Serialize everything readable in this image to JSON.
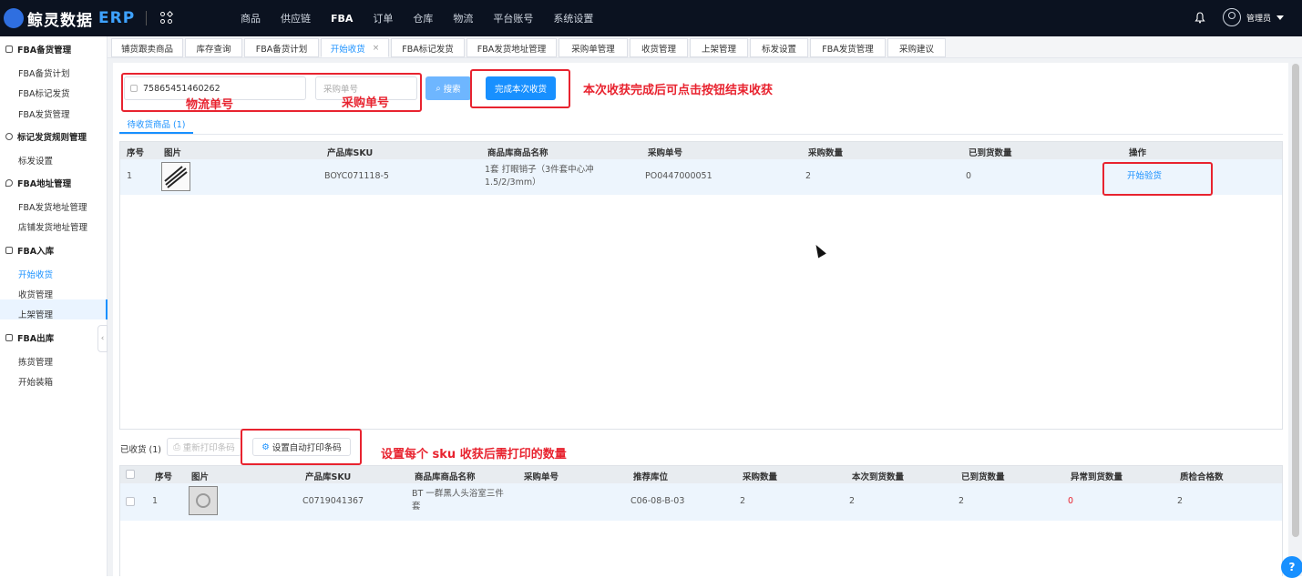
{
  "app": {
    "brand_name": "鲸灵数据",
    "brand_suffix": "ERP"
  },
  "nav": [
    "商品",
    "供应链",
    "FBA",
    "订单",
    "仓库",
    "物流",
    "平台账号",
    "系统设置"
  ],
  "nav_active": "FBA",
  "user": {
    "name": "管理员"
  },
  "sidebar": {
    "groups": [
      {
        "label": "FBA备货管理",
        "items": [
          "FBA备货计划",
          "FBA标记发货",
          "FBA发货管理"
        ]
      },
      {
        "label": "标记发货规则管理",
        "items": [
          "标发设置"
        ]
      },
      {
        "label": "FBA地址管理",
        "items": [
          "FBA发货地址管理",
          "店铺发货地址管理"
        ]
      },
      {
        "label": "FBA入库",
        "items": [
          "开始收货",
          "收货管理",
          "上架管理"
        ]
      },
      {
        "label": "FBA出库",
        "items": [
          "拣货管理",
          "开始装箱"
        ]
      }
    ],
    "active_item": "开始收货"
  },
  "tabs": [
    "铺货跟卖商品",
    "库存查询",
    "FBA备货计划",
    "开始收货",
    "FBA标记发货",
    "FBA发货地址管理",
    "采购单管理",
    "收货管理",
    "上架管理",
    "标发设置",
    "FBA发货管理",
    "采购建议"
  ],
  "tabs_close": "×",
  "search": {
    "tracking_value": "75865451460262",
    "po_placeholder": "采购单号",
    "search_label": "搜索",
    "finish_label": "完成本次收货"
  },
  "annotations": {
    "tracking": "物流单号",
    "po": "采购单号",
    "finish": "本次收获完成后可点击按钮结束收获",
    "print": "设置每个 sku 收获后需打印的数量"
  },
  "pending": {
    "tab_label": "待收货商品 (1)",
    "headers": [
      "序号",
      "图片",
      "产品库SKU",
      "商品库商品名称",
      "采购单号",
      "采购数量",
      "已到货数量",
      "操作"
    ],
    "rows": [
      {
        "no": "1",
        "sku": "BOYC071118-5",
        "name": "1套 打眼销子（3件套中心冲 1.5/2/3mm）",
        "po": "PO0447000051",
        "qty": "2",
        "arrived": "0",
        "action": "开始验货"
      }
    ]
  },
  "received": {
    "label": "已收货 (1)",
    "reprint_label": "重新打印条码",
    "auto_print_label": "设置自动打印条码",
    "headers": [
      "序号",
      "图片",
      "产品库SKU",
      "商品库商品名称",
      "采购单号",
      "推荐库位",
      "采购数量",
      "本次到货数量",
      "已到货数量",
      "异常到货数量",
      "质检合格数"
    ],
    "rows": [
      {
        "no": "1",
        "sku": "C0719041367",
        "name": "BT 一群黑人头浴室三件套",
        "po": "",
        "location": "C06-08-B-03",
        "qty": "2",
        "this_arrived": "2",
        "arrived": "2",
        "abnormal": "0",
        "qc_pass": "2"
      }
    ]
  },
  "colors": {
    "accent": "#1890ff",
    "annotation": "#e8232f",
    "topbar": "#0b1220"
  }
}
